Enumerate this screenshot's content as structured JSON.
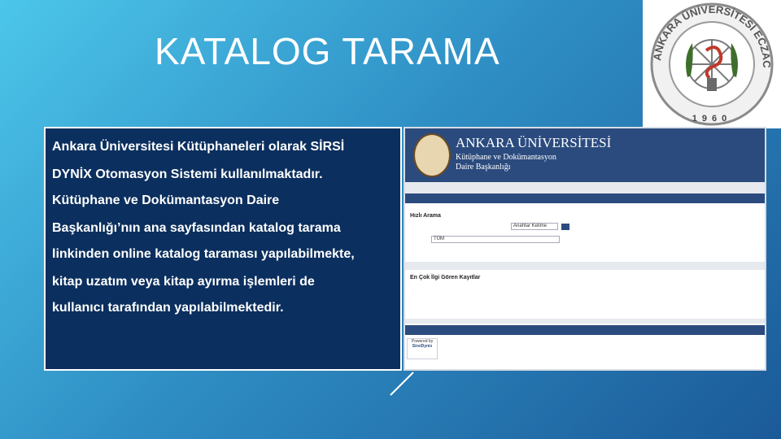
{
  "slide": {
    "title": "KATALOG TARAMA",
    "body_lines": [
      "Ankara Üniversitesi Kütüphaneleri olarak SİRSİ",
      "DYNİX Otomasyon Sistemi kullanılmaktadır.",
      "Kütüphane ve Dokümantasyon Daire",
      "Başkanlığı’nın ana sayfasından katalog tarama",
      "linkinden online katalog taraması yapılabilmekte,",
      "kitap uzatım veya kitap ayırma işlemleri de",
      "kullanıcı tarafından yapılabilmektedir."
    ]
  },
  "logo": {
    "ring_text": "ANKARA ÜNİVERSİTESİ ECZACILIK FAKÜLTESİ",
    "year": "1960"
  },
  "screenshot": {
    "university": "ANKARA ÜNİVERSİTESİ",
    "subtitle_1": "Kütüphane ve Dokümantasyon",
    "subtitle_2": "Daire Başkanlığı",
    "quick_search_title": "Hızlı Arama",
    "search_field_value": "Anahtar Kelime",
    "library_field_value": "TÜM",
    "popular_title": "En Çok İlgi Gören Kayıtlar",
    "powered_by": "Powered by",
    "powered_brand": "SirsiDynix"
  },
  "colors": {
    "panel_bg": "#0b2f5e",
    "header_blue": "#2b4b7e",
    "slide_gradient_start": "#4cc6ea",
    "slide_gradient_end": "#1b5a99"
  }
}
